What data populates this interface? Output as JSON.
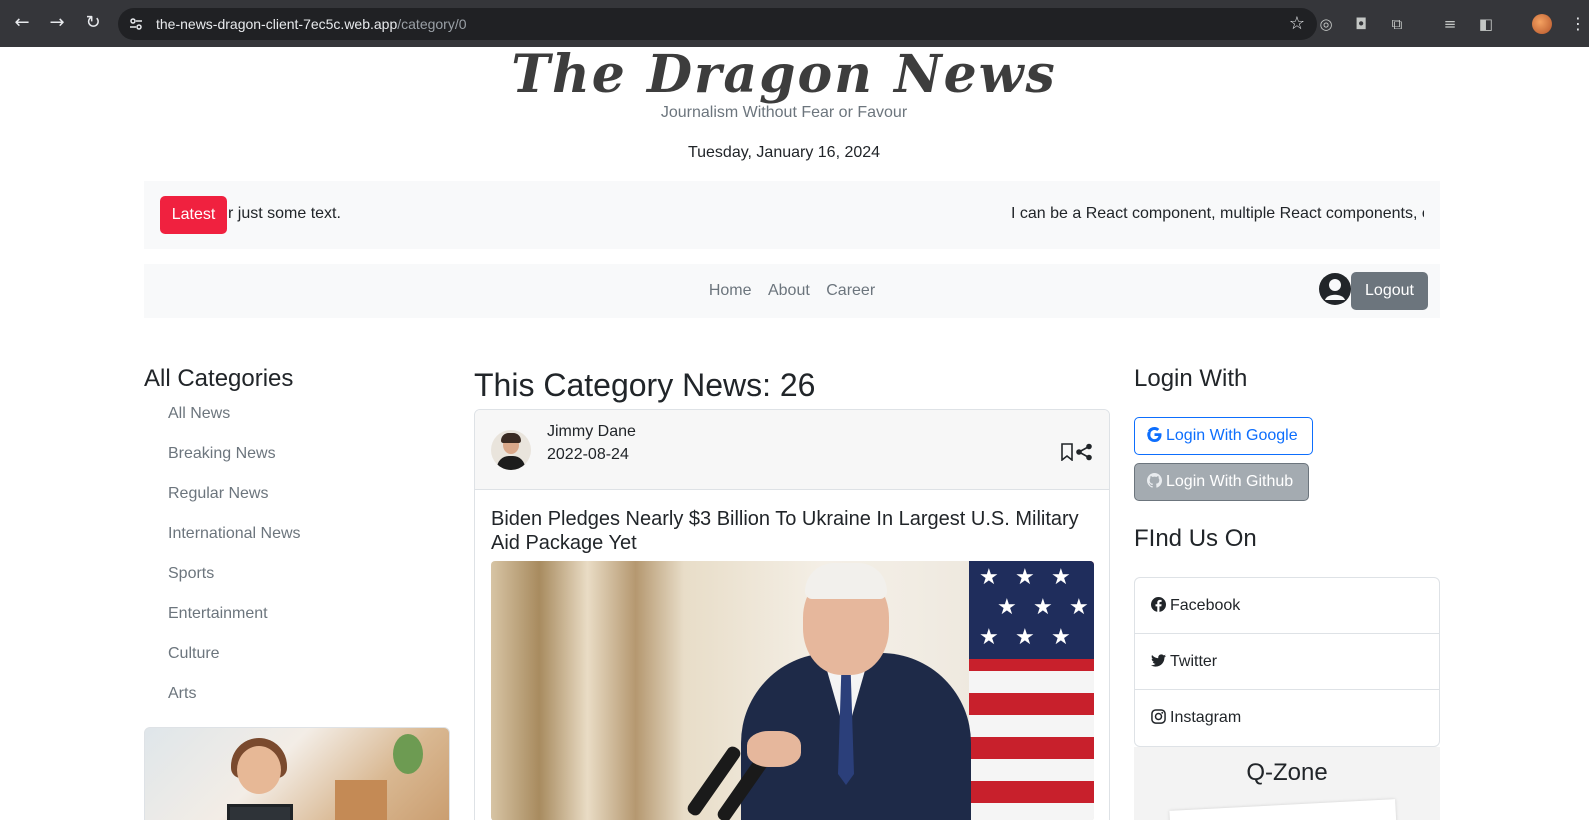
{
  "browser": {
    "url_host": "the-news-dragon-client-7ec5c.web.app",
    "url_path": "/category/0",
    "icons": [
      "back-icon",
      "forward-icon",
      "reload-icon",
      "site-settings-icon",
      "bookmark-star-icon",
      "extensions-icon",
      "profile-icon"
    ]
  },
  "header": {
    "logo": "The Dragon News",
    "tagline": "Journalism Without Fear or Favour",
    "date": "Tuesday, January 16, 2024"
  },
  "ticker": {
    "badge": "Latest",
    "text_left": "r just some text.",
    "text_right": "I can be a React component, multiple React components, o"
  },
  "nav": {
    "links": [
      "Home",
      "About",
      "Career"
    ],
    "logout": "Logout"
  },
  "categories": {
    "title": "All Categories",
    "items": [
      "All News",
      "Breaking News",
      "Regular News",
      "International News",
      "Sports",
      "Entertainment",
      "Culture",
      "Arts"
    ]
  },
  "main": {
    "heading": "This Category News: 26",
    "card": {
      "author": "Jimmy Dane",
      "date": "2022-08-24",
      "title": "Biden Pledges Nearly $3 Billion To Ukraine In Largest U.S. Military Aid Package Yet"
    }
  },
  "right": {
    "login_title": "Login With",
    "google_btn": "Login With Google",
    "github_btn": "Login With Github",
    "find_title": "FInd Us On",
    "social": [
      "Facebook",
      "Twitter",
      "Instagram"
    ],
    "qzone": "Q-Zone"
  }
}
